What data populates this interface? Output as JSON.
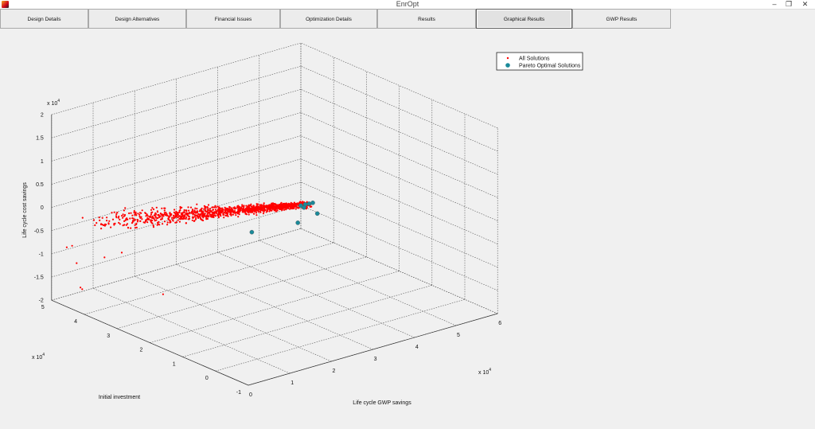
{
  "window": {
    "title": "EnrOpt",
    "minimize_glyph": "–",
    "restore_glyph": "❐",
    "close_glyph": "✕",
    "icon": "matlab-app-icon"
  },
  "tabs": [
    {
      "label": "Design Details",
      "active": false
    },
    {
      "label": "Design Alternatives",
      "active": false
    },
    {
      "label": "Financial Issues",
      "active": false
    },
    {
      "label": "Optimization Details",
      "active": false
    },
    {
      "label": "Results",
      "active": false
    },
    {
      "label": "Graphical Results",
      "active": true
    },
    {
      "label": "GWP Results",
      "active": false
    }
  ],
  "colors": {
    "all_solutions": "#ff0000",
    "pareto": "#1a8a9a",
    "grid": "#555555",
    "background": "#f0f0f0"
  },
  "chart_data": {
    "type": "scatter",
    "projection": "3d",
    "grid": true,
    "legend_placement": "top-right",
    "xlabel": "Life cycle GWP savings",
    "ylabel": "Initial investment",
    "zlabel": "Life cycle cost savings",
    "x_exponent": "x 10",
    "y_exponent": "x 10",
    "z_exponent": "x 10",
    "exponent_power": "4",
    "xlim": [
      0,
      6
    ],
    "ylim": [
      -1,
      5
    ],
    "zlim": [
      -2,
      2
    ],
    "x_ticks": [
      "0",
      "1",
      "2",
      "3",
      "4",
      "5",
      "6"
    ],
    "y_ticks": [
      "-1",
      "0",
      "1",
      "2",
      "3",
      "4",
      "5"
    ],
    "z_ticks": [
      "-2",
      "-1.5",
      "-1",
      "-0.5",
      "0",
      "0.5",
      "1",
      "1.5",
      "2"
    ],
    "series": [
      {
        "name": "All Solutions",
        "marker": "dot",
        "color": "#ff0000",
        "main_cloud": {
          "count": 1300,
          "x_range": [
            0.4,
            1.8
          ],
          "y_range": [
            4.3,
            -0.55
          ],
          "z_range": [
            -0.1,
            1.3
          ],
          "spread_y": 0.6,
          "spread_z": 0.14
        },
        "outliers": [
          {
            "x": 0.05,
            "y": 4.6,
            "z": -0.75
          },
          {
            "x": 0.1,
            "y": 4.5,
            "z": -0.7
          },
          {
            "x": 0.05,
            "y": 4.3,
            "z": -1.0
          },
          {
            "x": 0.3,
            "y": 4.5,
            "z": -1.65
          },
          {
            "x": 0.5,
            "y": 4.7,
            "z": -1.8
          },
          {
            "x": 1.5,
            "y": 3.5,
            "z": -1.8
          },
          {
            "x": 0.8,
            "y": 4.4,
            "z": -1.1
          },
          {
            "x": 0.9,
            "y": 4.0,
            "z": -0.9
          }
        ]
      },
      {
        "name": "Pareto Optimal Solutions",
        "marker": "circle",
        "color": "#1a8a9a",
        "points": [
          {
            "x": 1.72,
            "y": -0.42,
            "z": 1.25
          },
          {
            "x": 1.75,
            "y": -0.52,
            "z": 1.3
          },
          {
            "x": 1.78,
            "y": -0.6,
            "z": 1.33
          },
          {
            "x": 1.82,
            "y": -0.66,
            "z": 1.36
          },
          {
            "x": 1.75,
            "y": -0.48,
            "z": 1.22
          },
          {
            "x": 1.93,
            "y": -0.66,
            "z": 1.1
          },
          {
            "x": 1.68,
            "y": -0.38,
            "z": 0.88
          },
          {
            "x": 1.6,
            "y": 0.92,
            "z": 0.3
          }
        ]
      }
    ]
  }
}
